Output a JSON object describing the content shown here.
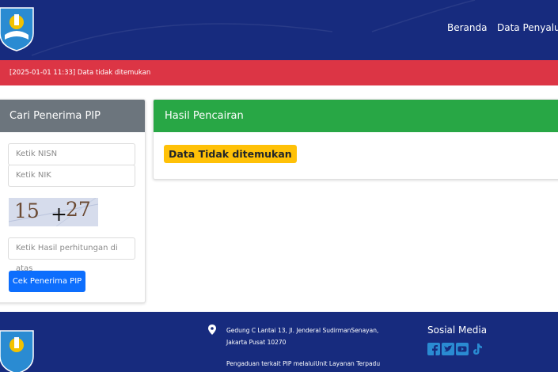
{
  "header": {
    "nav": [
      {
        "label": "Beranda"
      },
      {
        "label": "Data Penyaluran"
      }
    ]
  },
  "alert": {
    "text": "[2025-01-01 11:33] Data tidak ditemukan"
  },
  "search_card": {
    "title": "Cari Penerima PIP",
    "nisn_placeholder": "Ketik NISN",
    "nik_placeholder": "Ketik NIK",
    "captcha": {
      "left": "15",
      "op": "+",
      "right": "27"
    },
    "answer_placeholder": "Ketik Hasil perhitungan di atas",
    "submit_label": "Cek Penerima PIP"
  },
  "result_card": {
    "title": "Hasil Pencairan",
    "message": "Data Tidak ditemukan"
  },
  "footer": {
    "address": "Gedung C Lantai 13, Jl. Jenderal SudirmanSenayan, Jakarta Pusat 10270",
    "complaint": "Pengaduan terkait PIP melaluiUnit Layanan Terpadu",
    "social_title": "Sosial Media",
    "social_icons": [
      "facebook-icon",
      "twitter-icon",
      "youtube-icon",
      "tiktok-icon"
    ]
  },
  "colors": {
    "navy": "#172b7e",
    "alert_red": "#dc3545",
    "success_green": "#28a745",
    "muted_gray": "#6c757d",
    "primary_blue": "#0d6efd",
    "warning_yellow": "#ffc107"
  }
}
